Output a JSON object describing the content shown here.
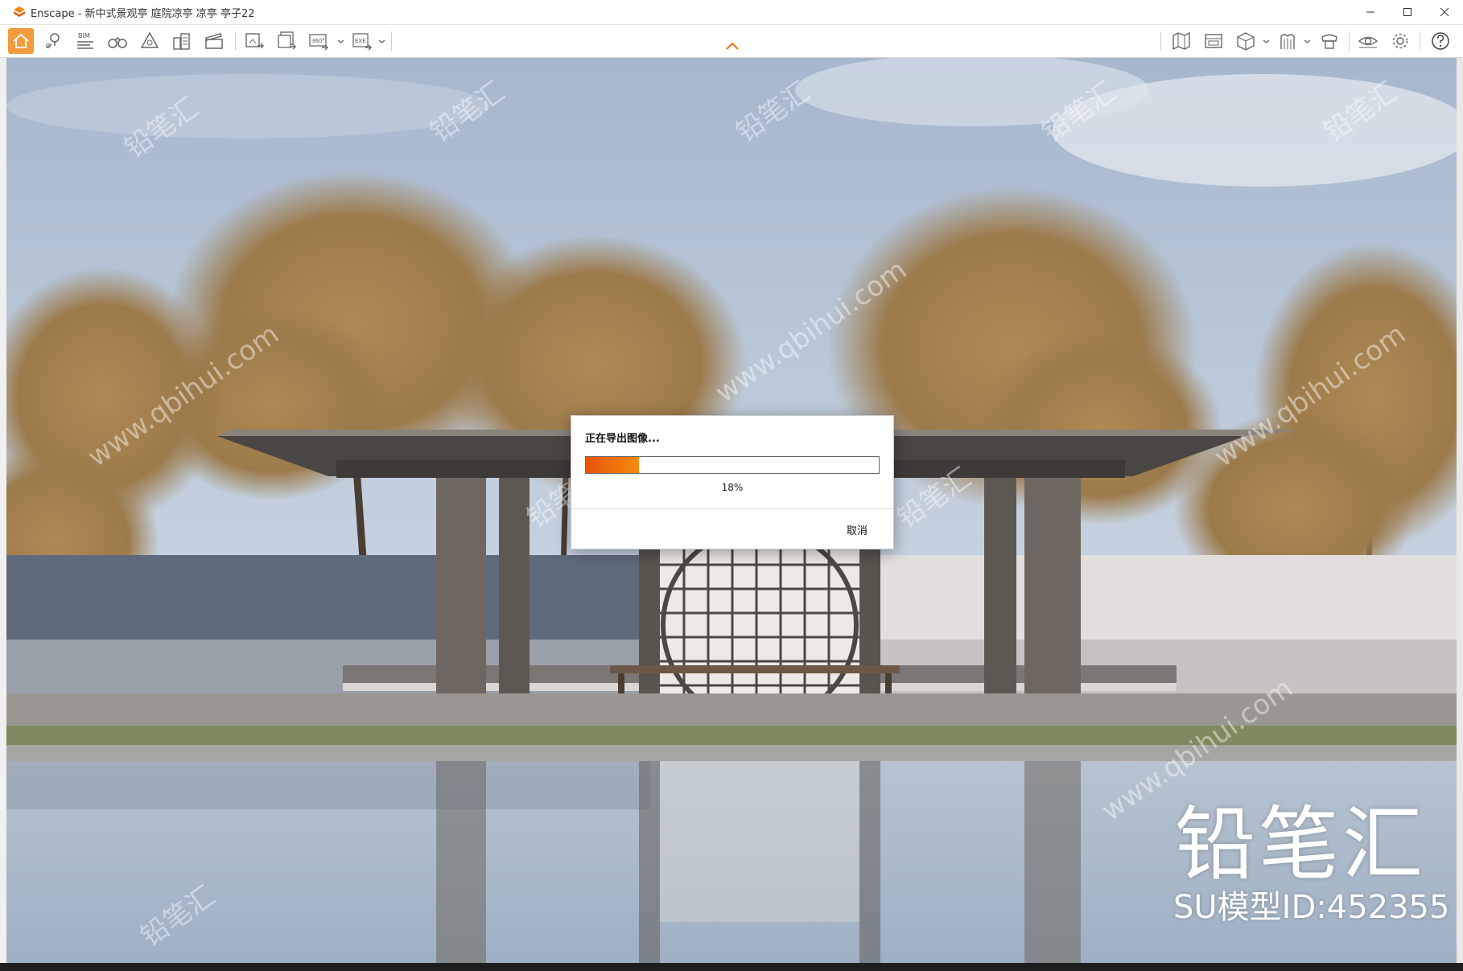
{
  "window": {
    "title": "Enscape - 新中式景观亭 庭院凉亭 凉亭 亭子22",
    "controls": [
      "minimize-icon",
      "maximize-icon",
      "close-icon"
    ]
  },
  "toolbar": {
    "left_buttons": [
      "home-icon",
      "location-pin-icon",
      "bim-icon",
      "binoculars-icon",
      "perspective-icon",
      "buildings-icon",
      "clapperboard-icon",
      "screenshot-icon",
      "batch-render-icon",
      "panorama-360-icon",
      "exe-export-icon"
    ],
    "right_buttons": [
      "map-icon",
      "asset-library-icon",
      "cube-icon",
      "material-editor-icon",
      "visual-settings-icon",
      "view-eye-icon",
      "settings-gear-icon",
      "help-icon"
    ],
    "bim_label": "BIM",
    "pano_label": "360°",
    "exe_label": "EXE"
  },
  "dialog": {
    "heading": "正在导出图像...",
    "progress": 18,
    "percent_text": "18%",
    "cancel_label": "取消",
    "accent_color": "#f07a10"
  },
  "watermark": {
    "brand": "铅笔汇",
    "model_id": "SU模型ID:452355",
    "tiles": [
      "铅笔汇",
      "www.qbihui.com"
    ]
  }
}
